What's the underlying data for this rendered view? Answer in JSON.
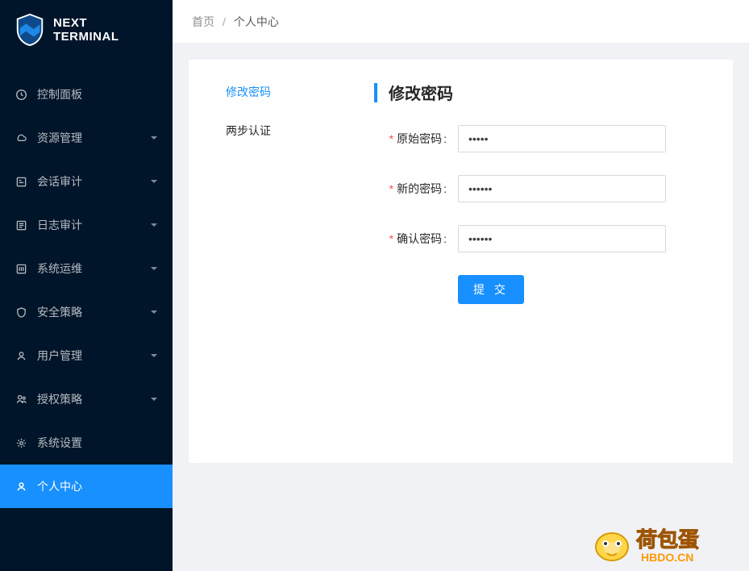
{
  "product": {
    "name_line1": "NEXT",
    "name_line2": "TERMINAL"
  },
  "sidebar": {
    "items": [
      {
        "label": "控制面板",
        "expandable": false
      },
      {
        "label": "资源管理",
        "expandable": true
      },
      {
        "label": "会话审计",
        "expandable": true
      },
      {
        "label": "日志审计",
        "expandable": true
      },
      {
        "label": "系统运维",
        "expandable": true
      },
      {
        "label": "安全策略",
        "expandable": true
      },
      {
        "label": "用户管理",
        "expandable": true
      },
      {
        "label": "授权策略",
        "expandable": true
      },
      {
        "label": "系统设置",
        "expandable": false
      },
      {
        "label": "个人中心",
        "expandable": false,
        "active": true
      }
    ]
  },
  "breadcrumb": {
    "root": "首页",
    "sep": "/",
    "current": "个人中心"
  },
  "tabs": [
    {
      "label": "修改密码",
      "active": true
    },
    {
      "label": "两步认证",
      "active": false
    }
  ],
  "panel": {
    "title": "修改密码",
    "fields": {
      "old_password": {
        "label": "原始密码",
        "required": true,
        "value": "•••••"
      },
      "new_password": {
        "label": "新的密码",
        "required": true,
        "value": "••••••"
      },
      "confirm_password": {
        "label": "确认密码",
        "required": true,
        "value": "••••••"
      }
    },
    "submit_label": "提 交"
  },
  "watermark": {
    "text_main": "荷包蛋",
    "text_sub": "HBDO.CN"
  },
  "colors": {
    "primary": "#1890ff",
    "sidebar_bg": "#001529",
    "danger": "#ff4d4f"
  }
}
